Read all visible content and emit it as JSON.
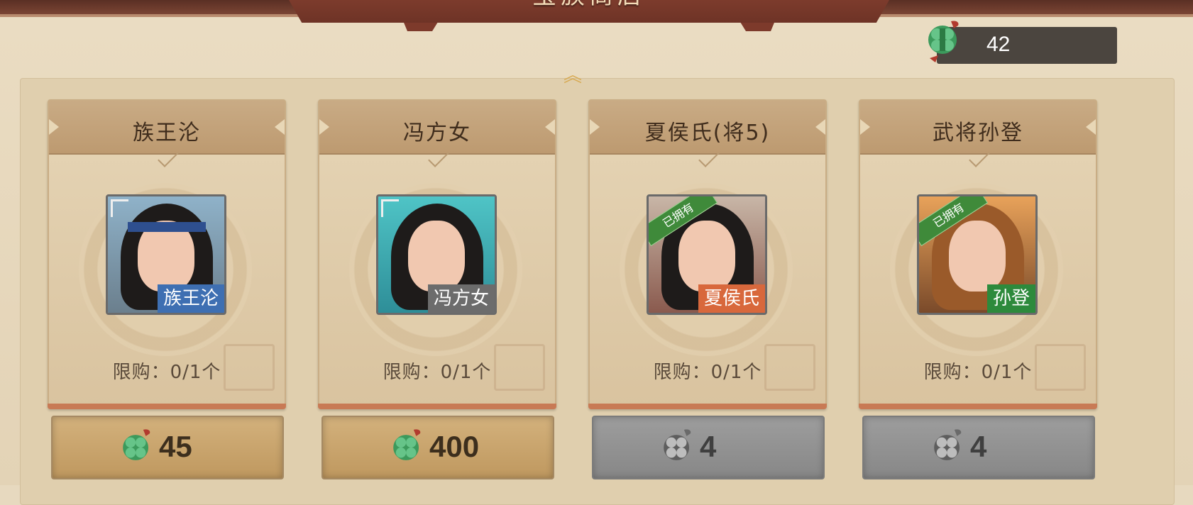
{
  "header": {
    "title": "宝族商店"
  },
  "currency": {
    "amount": "42",
    "icon": "jade-knot-icon"
  },
  "cards": [
    {
      "name": "族王沦",
      "tag": "族王沦",
      "tag_color": "#3e6fb2",
      "owned_label": "",
      "limit": "限购：0/1个",
      "price": "45",
      "price_state": "gold"
    },
    {
      "name": "冯方女",
      "tag": "冯方女",
      "tag_color": "#6c6c6c",
      "owned_label": "",
      "limit": "限购：0/1个",
      "price": "400",
      "price_state": "gold"
    },
    {
      "name": "夏侯氏(将5)",
      "tag": "夏侯氏",
      "tag_color": "#d8683c",
      "owned_label": "已拥有",
      "limit": "限购：0/1个",
      "price": "4",
      "price_state": "gray"
    },
    {
      "name": "武将孙登",
      "tag": "孙登",
      "tag_color": "#2d8a3c",
      "owned_label": "已拥有",
      "limit": "限购：0/1个",
      "price": "4",
      "price_state": "gray"
    }
  ],
  "colors": {
    "accent_gold": "#d8aa52",
    "owned_green": "#3f8a3a"
  }
}
